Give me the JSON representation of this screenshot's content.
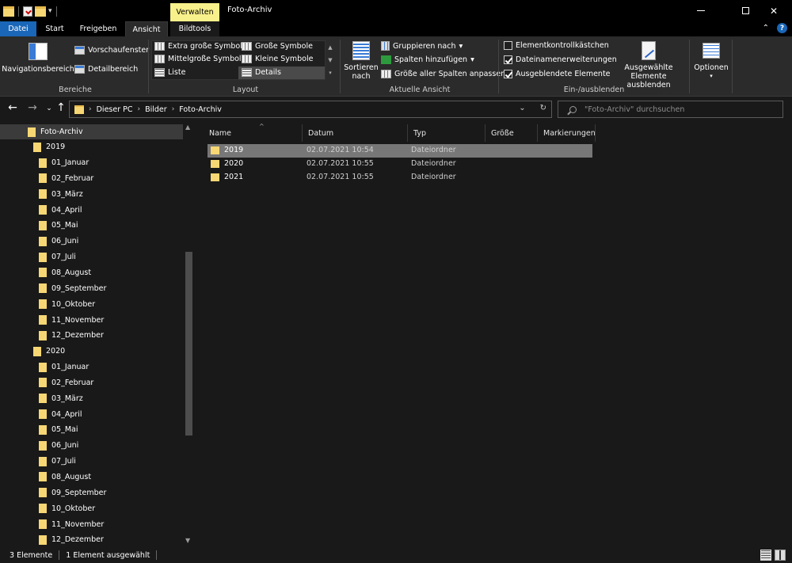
{
  "titlebar": {
    "context_tab": "Verwalten",
    "title": "Foto-Archiv"
  },
  "ribbon_tabs": {
    "datei": "Datei",
    "start": "Start",
    "freigeben": "Freigeben",
    "ansicht": "Ansicht",
    "bildtools": "Bildtools"
  },
  "ribbon": {
    "bereiche": {
      "label": "Bereiche",
      "navigationsbereich": "Navigationsbereich",
      "vorschaufenster": "Vorschaufenster",
      "detailbereich": "Detailbereich"
    },
    "layout": {
      "label": "Layout",
      "extra_gross": "Extra große Symbole",
      "gross": "Große Symbole",
      "mittelgross": "Mittelgroße Symbole",
      "klein": "Kleine Symbole",
      "liste": "Liste",
      "details": "Details"
    },
    "aktuelle_ansicht": {
      "label": "Aktuelle Ansicht",
      "sortieren": "Sortieren",
      "sortieren2": "nach",
      "gruppieren": "Gruppieren nach",
      "spalten": "Spalten hinzufügen",
      "groesse": "Größe aller Spalten anpassen"
    },
    "ein_aus": {
      "label": "Ein-/ausblenden",
      "elementkontroll": "Elementkontrollkästchen",
      "dateinamen": "Dateinamenerweiterungen",
      "ausgeblendete": "Ausgeblendete Elemente",
      "ausgewaehlte": "Ausgewählte",
      "ausgewaehlte2": "Elemente ausblenden"
    },
    "optionen": "Optionen"
  },
  "address": {
    "crumbs": [
      "Dieser PC",
      "Bilder",
      "Foto-Archiv"
    ],
    "search_placeholder": "\"Foto-Archiv\" durchsuchen"
  },
  "nav_tree": {
    "root": "Foto-Archiv",
    "year1": "2019",
    "months1": [
      "01_Januar",
      "02_Februar",
      "03_März",
      "04_April",
      "05_Mai",
      "06_Juni",
      "07_Juli",
      "08_August",
      "09_September",
      "10_Oktober",
      "11_November",
      "12_Dezember"
    ],
    "year2": "2020",
    "months2": [
      "01_Januar",
      "02_Februar",
      "03_März",
      "04_April",
      "05_Mai",
      "06_Juni",
      "07_Juli",
      "08_August",
      "09_September",
      "10_Oktober",
      "11_November",
      "12_Dezember"
    ]
  },
  "columns": [
    "Name",
    "Datum",
    "Typ",
    "Größe",
    "Markierungen"
  ],
  "rows": [
    {
      "name": "2019",
      "datum": "02.07.2021 10:54",
      "typ": "Dateiordner"
    },
    {
      "name": "2020",
      "datum": "02.07.2021 10:55",
      "typ": "Dateiordner"
    },
    {
      "name": "2021",
      "datum": "02.07.2021 10:55",
      "typ": "Dateiordner"
    }
  ],
  "status": {
    "count": "3 Elemente",
    "selected": "1 Element ausgewählt"
  }
}
